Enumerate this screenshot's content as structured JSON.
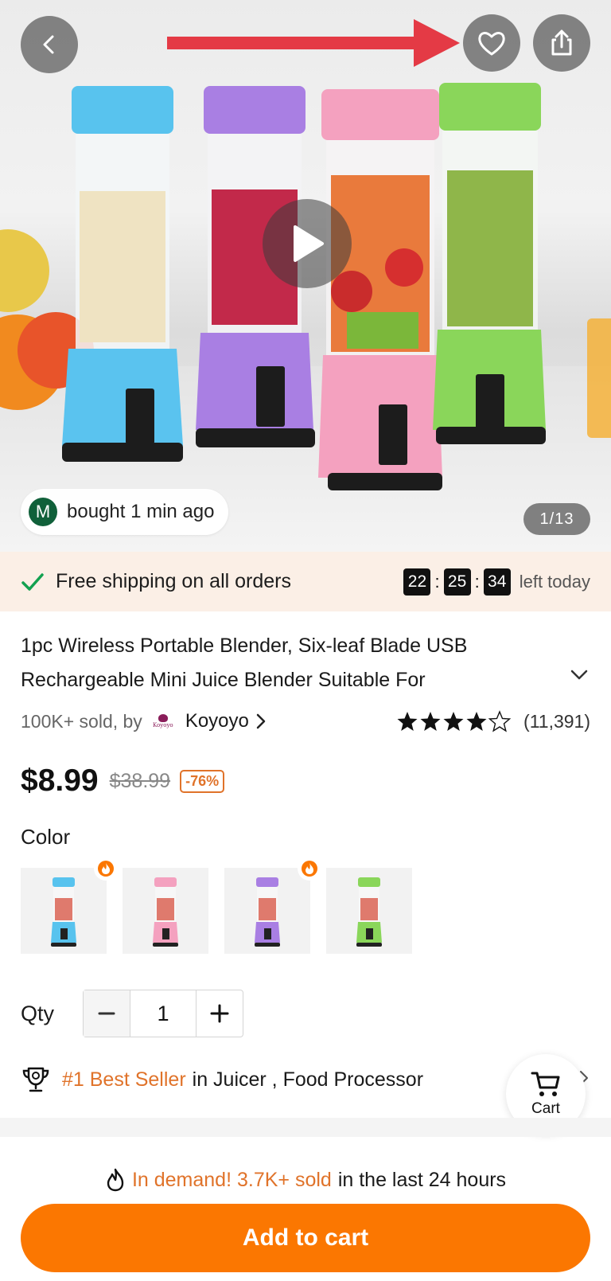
{
  "hero": {
    "bought_avatar_letter": "M",
    "bought_text": "bought 1 min ago",
    "image_counter": "1/13"
  },
  "icons": {
    "back": "chevron-left-icon",
    "favorite": "heart-icon",
    "share": "share-icon",
    "play": "play-icon",
    "annotation": "red-arrow-icon"
  },
  "shipping": {
    "text": "Free shipping on all orders",
    "timer": {
      "hours": "22",
      "minutes": "25",
      "seconds": "34"
    },
    "suffix": "left today"
  },
  "product": {
    "title_line1": "1pc Wireless Portable Blender, Six-leaf Blade USB",
    "title_line2": "Rechargeable Mini Juice Blender Suitable For",
    "sold": "100K+ sold, by",
    "store_logo_text": "Koyoyo",
    "store_name": "Koyoyo",
    "rating": 4.5,
    "rating_count": "(11,391)",
    "price": "$8.99",
    "original_price": "$38.99",
    "discount": "-76%"
  },
  "color": {
    "label": "Color",
    "options": [
      {
        "name": "blue",
        "hex": "#58c3ee",
        "hot": true
      },
      {
        "name": "pink",
        "hex": "#f4a1bf",
        "hot": false
      },
      {
        "name": "purple",
        "hex": "#a97fe3",
        "hot": true
      },
      {
        "name": "green",
        "hex": "#8ad65a",
        "hot": false
      }
    ]
  },
  "qty": {
    "label": "Qty",
    "value": "1"
  },
  "bestseller": {
    "rank": "#1 Best Seller",
    "text": "in Juicer , Food Processor"
  },
  "cart": {
    "label": "Cart"
  },
  "demand": {
    "highlight": "In demand! 3.7K+ sold",
    "rest": "in the last 24 hours"
  },
  "add_to_cart": "Add to cart",
  "colors": {
    "accent": "#fb7701",
    "orange_text": "#e0732a",
    "ship_bg": "#fbefe6",
    "check_green": "#12a150",
    "arrow_red": "#e43a45"
  }
}
